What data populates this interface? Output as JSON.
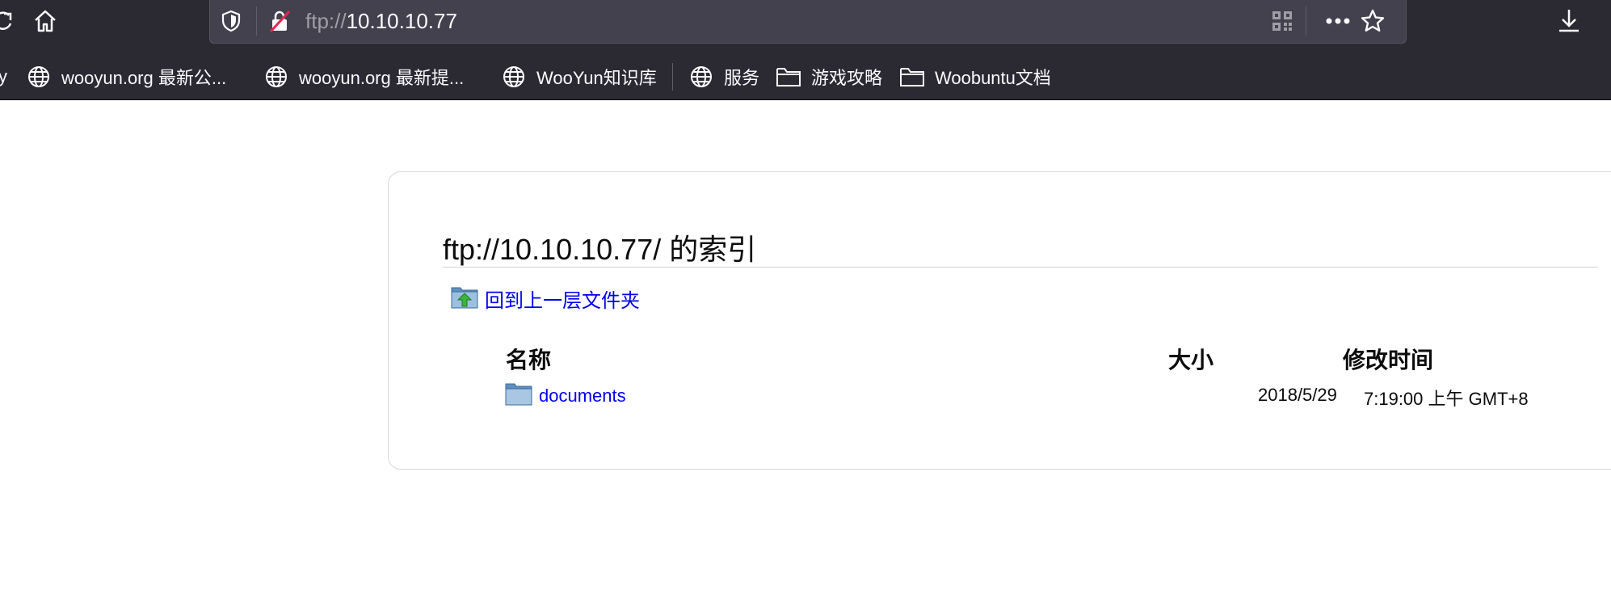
{
  "browser": {
    "url_scheme": "ftp://",
    "url_host": "10.10.10.77",
    "bookmarks_partial_left": "y",
    "bookmarks": [
      {
        "label": "wooyun.org 最新公...",
        "icon": "globe-icon"
      },
      {
        "label": "wooyun.org 最新提...",
        "icon": "globe-icon"
      },
      {
        "label": "WooYun知识库",
        "icon": "globe-icon"
      },
      {
        "label": "服务",
        "icon": "globe-icon"
      },
      {
        "label": "游戏攻略",
        "icon": "folder-icon"
      },
      {
        "label": "Woobuntu文档",
        "icon": "folder-icon"
      }
    ]
  },
  "page": {
    "title": "ftp://10.10.10.77/ 的索引",
    "up_link": "回到上一层文件夹",
    "columns": {
      "name": "名称",
      "size": "大小",
      "modified": "修改时间"
    },
    "rows": [
      {
        "name": "documents",
        "size": "",
        "date": "2018/5/29",
        "time": "7:19:00 上午 GMT+8",
        "icon": "folder-icon"
      }
    ]
  },
  "colors": {
    "chrome": "#2b2a33",
    "urlbar": "#42414d",
    "link": "#0000ee"
  }
}
